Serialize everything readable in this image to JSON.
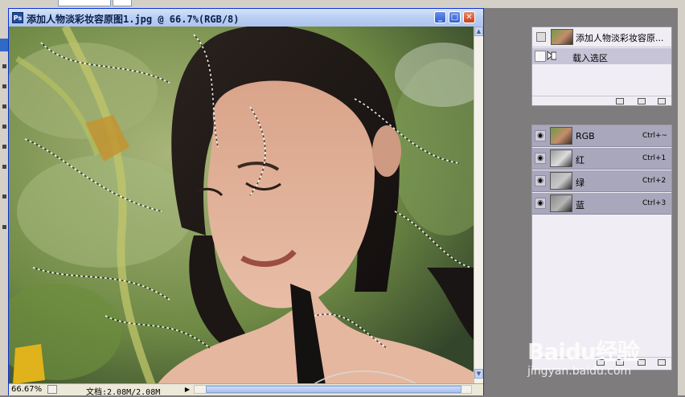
{
  "document": {
    "title": "添加人物淡彩妆容原图1.jpg @ 66.7%(RGB/8)",
    "icon_label": "Ps",
    "window_buttons": [
      "minimize-icon",
      "restore-icon",
      "close-icon"
    ]
  },
  "status": {
    "zoom": "66.67%",
    "doc_info": "文档:2.08M/2.08M",
    "arrow": "▶"
  },
  "history": {
    "source_label": "添加人物淡彩妆容原...",
    "step_label": "载入选区"
  },
  "channels": [
    {
      "name": "RGB",
      "shortcut": "Ctrl+~"
    },
    {
      "name": "红",
      "shortcut": "Ctrl+1"
    },
    {
      "name": "绿",
      "shortcut": "Ctrl+2"
    },
    {
      "name": "蓝",
      "shortcut": "Ctrl+3"
    }
  ],
  "watermark": {
    "logo": "Baidu经验",
    "url": "jingyan.baidu.com"
  },
  "colors": {
    "titlebar": "#b9cef2",
    "selected_row": "#c6c4d6",
    "channel_row": "#a9a7bb"
  }
}
